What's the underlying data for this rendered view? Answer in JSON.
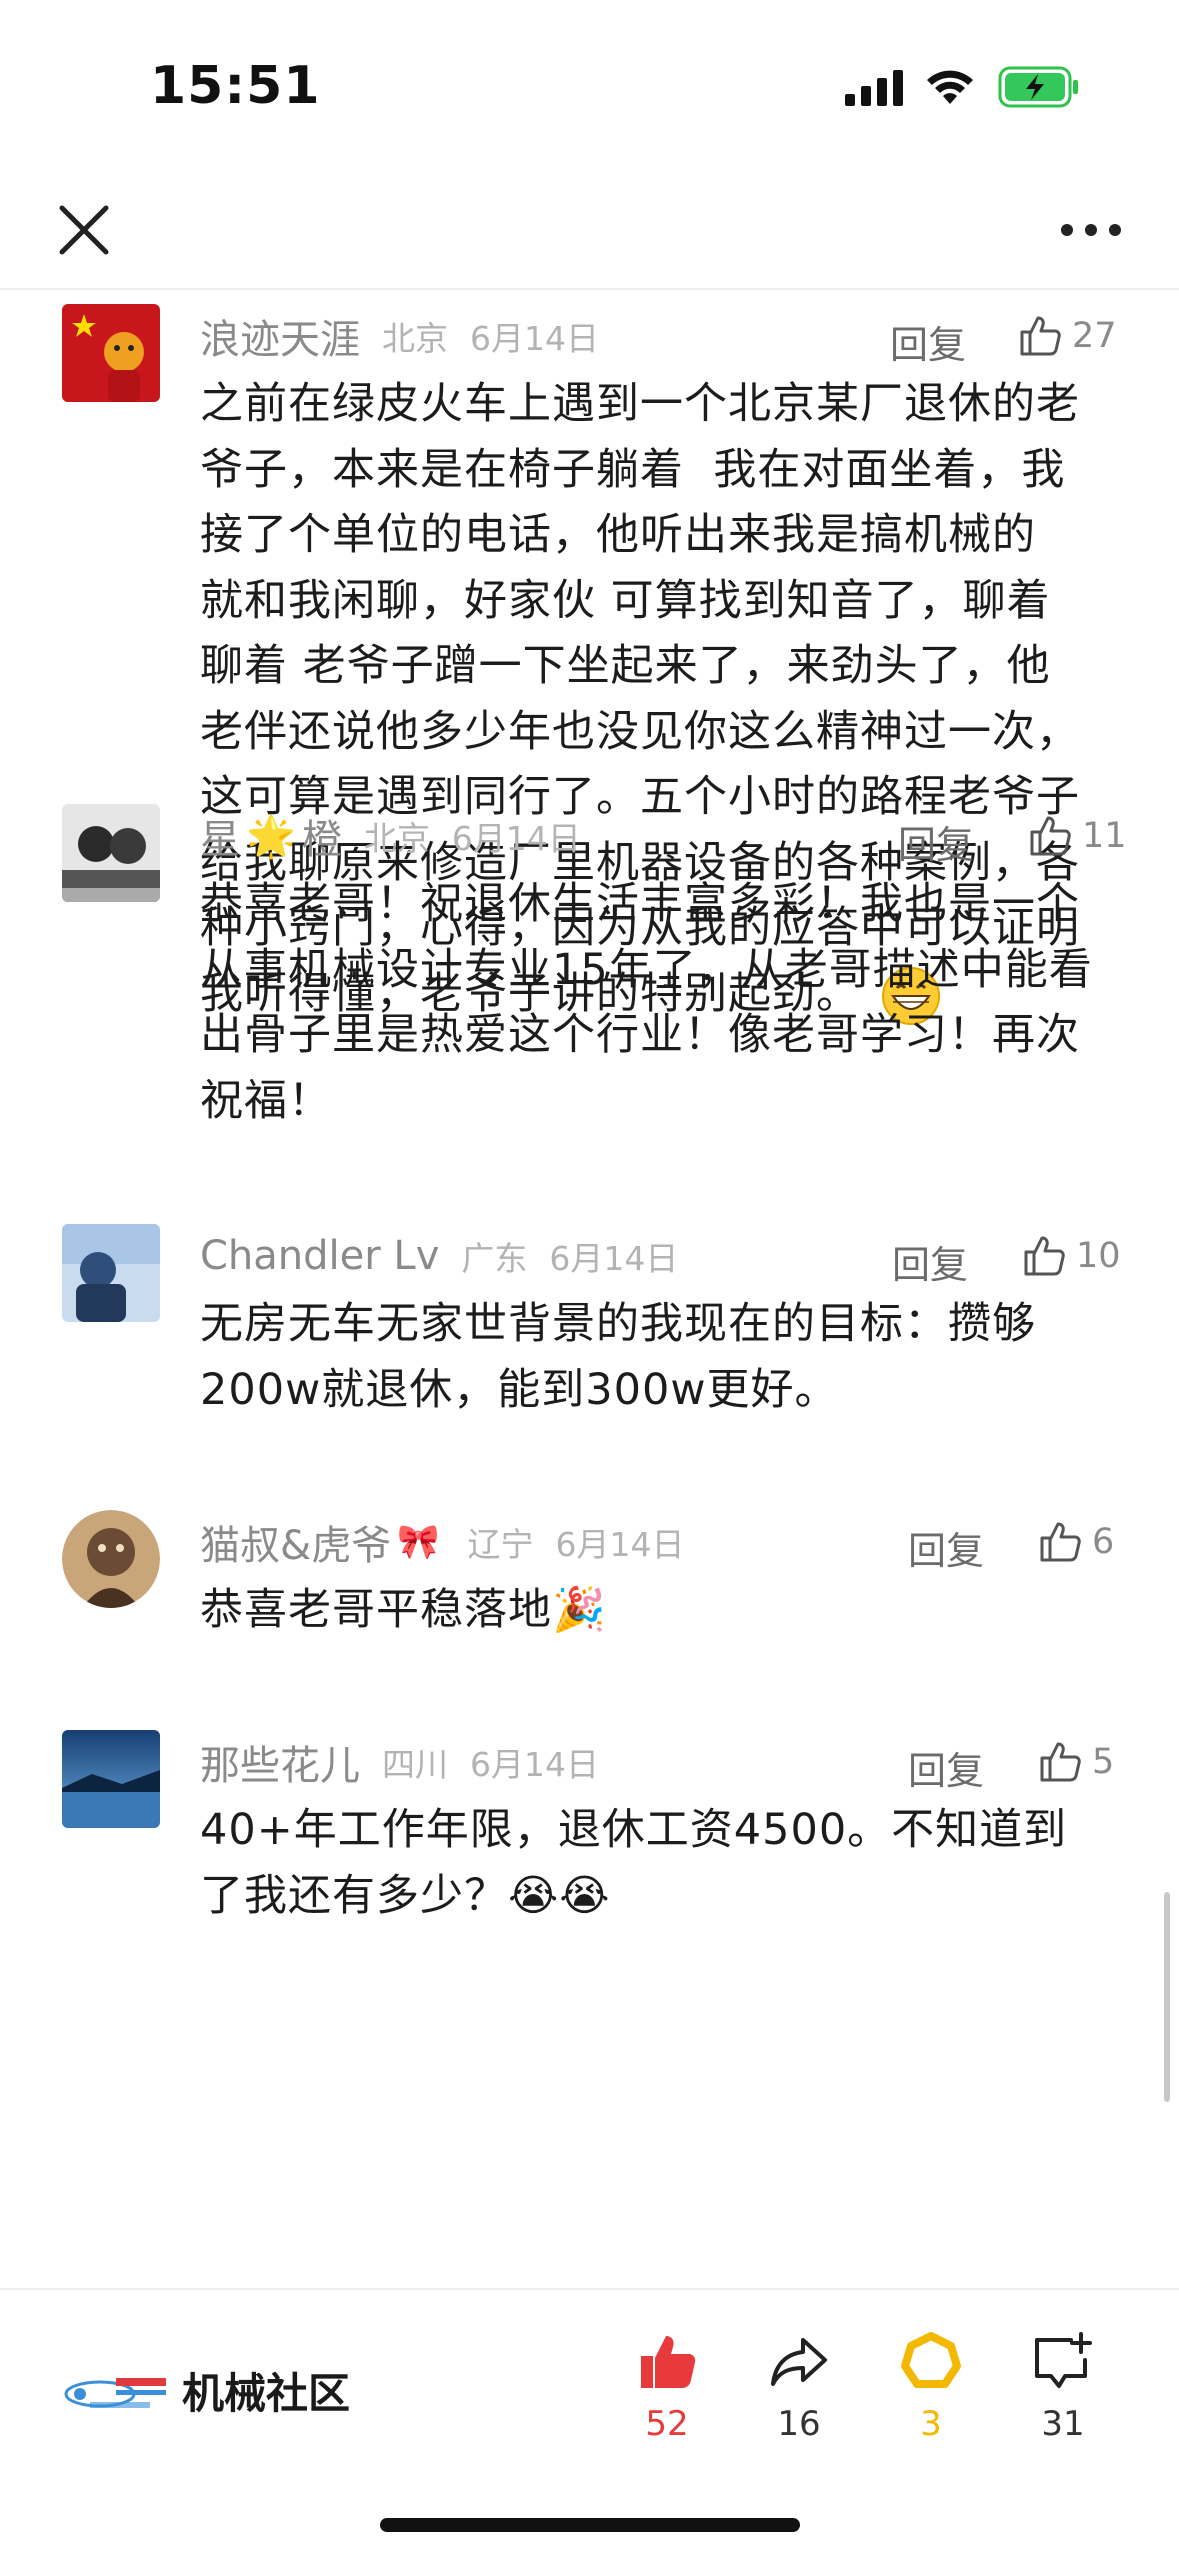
{
  "status_bar": {
    "time": "15:51"
  },
  "nav": {
    "close_icon": "close-icon",
    "more_icon": "more-icon"
  },
  "comments": [
    {
      "username": "浪迹天涯",
      "location": "北京",
      "date": "6月14日",
      "reply_label": "回复",
      "likes": "27",
      "avatar_colors": [
        "#c8161d",
        "#f0a020"
      ],
      "lines": [
        "之前在绿皮火车上遇到一个北京某厂退休的老",
        "爷子，本来是在椅子躺着  我在对面坐着，我",
        "接了个单位的电话，他听出来我是搞机械的",
        "就和我闲聊，好家伙 可算找到知音了，聊着",
        "聊着 老爷子蹭一下坐起来了，来劲头了，他",
        "老伴还说他多少年也没见你这么精神过一次，",
        "这可算是遇到同行了。五个小时的路程老爷子",
        "给我聊原来修造厂里机器设备的各种案例，各",
        "种小窍门，心得，因为从我的应答中可以证明",
        "我听得懂，老爷子讲的特别起劲。"
      ],
      "trailing_emoji": "grin-emoji"
    },
    {
      "username_prefix": "星",
      "username_emoji": "🌟",
      "username_suffix": "橙",
      "location": "北京",
      "date": "6月14日",
      "reply_label": "回复",
      "likes": "11",
      "avatar_colors": [
        "#222222",
        "#dddddd"
      ],
      "lines": [
        "恭喜老哥！祝退休生活丰富多彩！我也是一个",
        "从事机械设计专业15年了，从老哥描述中能看",
        "出骨子里是热爱这个行业！像老哥学习！再次",
        "祝福！"
      ]
    },
    {
      "username": "Chandler Lv",
      "location": "广东",
      "date": "6月14日",
      "reply_label": "回复",
      "likes": "10",
      "avatar_colors": [
        "#3a6db3",
        "#c9dcef"
      ],
      "lines": [
        "无房无车无家世背景的我现在的目标：攒够",
        "200w就退休，能到300w更好。"
      ]
    },
    {
      "username": "猫叔&虎爷",
      "username_emoji": "🎀",
      "location": "辽宁",
      "date": "6月14日",
      "reply_label": "回复",
      "likes": "6",
      "avatar_colors": [
        "#6b4b34",
        "#c9a57a"
      ],
      "lines": [
        "恭喜老哥平稳落地🎉"
      ]
    },
    {
      "username": "那些花儿",
      "location": "四川",
      "date": "6月14日",
      "reply_label": "回复",
      "likes": "5",
      "avatar_colors": [
        "#1e4e86",
        "#6fb1e6"
      ],
      "lines": [
        "40+年工作年限，退休工资4500。不知道到",
        "了我还有多少？😭😭"
      ]
    }
  ],
  "bottom_bar": {
    "community_name": "机械社区",
    "like_count": "52",
    "share_count": "16",
    "collect_count": "3",
    "comment_count": "31",
    "like_color": "#e83a3a",
    "collect_color": "#f5b800"
  }
}
